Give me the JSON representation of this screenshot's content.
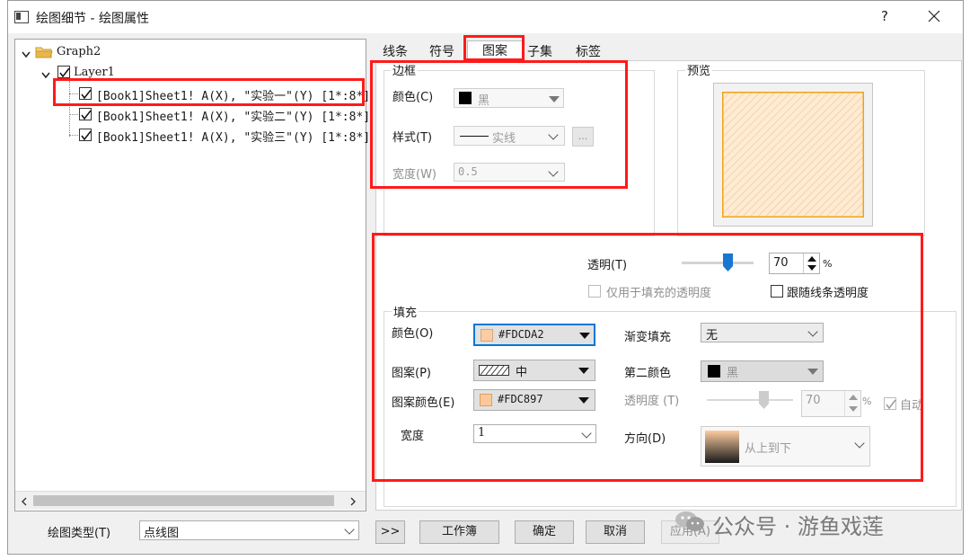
{
  "window": {
    "title": "绘图细节 - 绘图属性",
    "help": "?"
  },
  "tree": {
    "root": "Graph2",
    "layer": "Layer1",
    "items": [
      "[Book1]Sheet1! A(X), \"实验一\"(Y) [1*:8*]",
      "[Book1]Sheet1! A(X), \"实验二\"(Y) [1*:8*]",
      "[Book1]Sheet1! A(X), \"实验三\"(Y) [1*:8*]"
    ]
  },
  "tabs": [
    "线条",
    "符号",
    "图案",
    "子集",
    "标签"
  ],
  "border_group": {
    "title": "边框",
    "color_label": "颜色(C)",
    "color_value": "黑",
    "style_label": "样式(T)",
    "style_value": "实线",
    "style_more": "...",
    "width_label": "宽度(W)",
    "width_value": "0.5"
  },
  "preview": {
    "title": "预览",
    "fill_color": "#FDCDA2",
    "pattern_color": "#FDC897"
  },
  "transparency": {
    "label": "透明(T)",
    "value": "70",
    "unit": "%",
    "level": 0.7,
    "only_fill": "仅用于填充的透明度",
    "follow_line": "跟随线条透明度"
  },
  "fill_group": {
    "title": "填充",
    "color_label": "颜色(O)",
    "color_value": "#FDCDA2",
    "color_hex": "#FDCDA2",
    "gradient_label": "渐变填充",
    "gradient_value": "无",
    "pattern_label": "图案(P)",
    "pattern_value": "中",
    "second_color_label": "第二颜色",
    "second_color_value": "黑",
    "pattern_color_label": "图案颜色(E)",
    "pattern_color_value": "#FDC897",
    "pattern_color_hex": "#FDC897",
    "opacity_label": "透明度 (T)",
    "opacity_value": "70",
    "opacity_unit": "%",
    "auto_label": "自动",
    "width_label": "宽度",
    "width_value": "1",
    "direction_label": "方向(D)",
    "direction_value": "从上到下"
  },
  "footer": {
    "plot_type_label": "绘图类型(T)",
    "plot_type_value": "点线图",
    "expand": ">>",
    "workbook": "工作簿",
    "ok": "确定",
    "cancel": "取消",
    "apply": "应用(A)"
  },
  "watermark": "公众号 · 游鱼戏莲",
  "colors": {
    "accent_red": "#FF1A1A",
    "folder": "#E8B64A"
  }
}
